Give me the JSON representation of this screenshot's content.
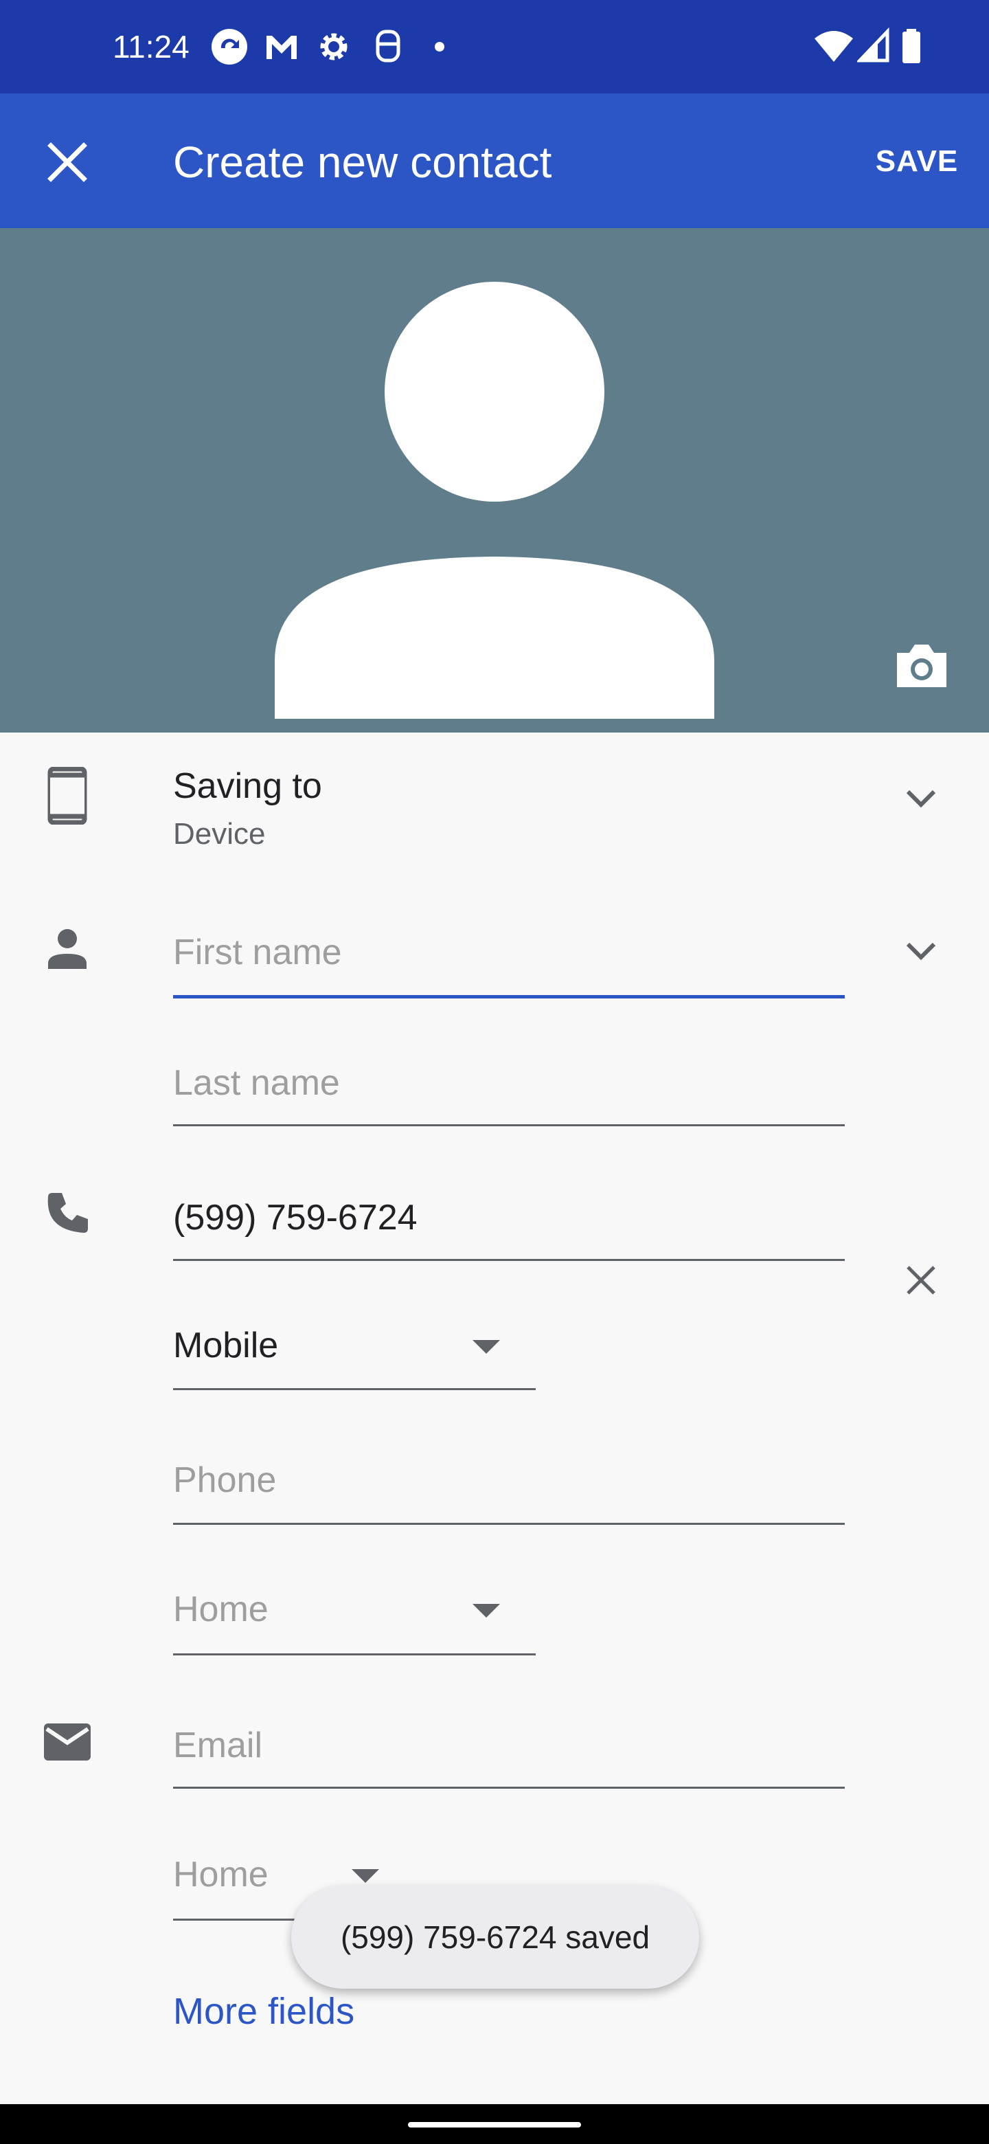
{
  "status_bar": {
    "time": "11:24",
    "icons": [
      "sync-icon",
      "gmail-icon",
      "settings-icon",
      "nfc-icon",
      "dot-icon",
      "wifi-icon",
      "signal-icon",
      "battery-icon"
    ]
  },
  "app_bar": {
    "title": "Create new contact",
    "save_label": "SAVE",
    "close_icon": "close-icon"
  },
  "photo": {
    "avatar_icon": "person-silhouette",
    "camera_icon": "camera-icon",
    "background_color": "#607d8b"
  },
  "saving_to": {
    "label": "Saving to",
    "value": "Device"
  },
  "name": {
    "first_name_placeholder": "First name",
    "last_name_placeholder": "Last name"
  },
  "phone": {
    "value": "(599) 759-6724",
    "type": "Mobile",
    "new_placeholder": "Phone",
    "new_type": "Home"
  },
  "email": {
    "placeholder": "Email",
    "type": "Home"
  },
  "snackbar": {
    "message": "(599) 759-6724 saved"
  },
  "more_fields_label": "More fields",
  "colors": {
    "status_bar": "#1c3aa9",
    "app_bar": "#2c56c6",
    "accent": "#2c56c6",
    "focused_underline": "#2c56c6"
  }
}
